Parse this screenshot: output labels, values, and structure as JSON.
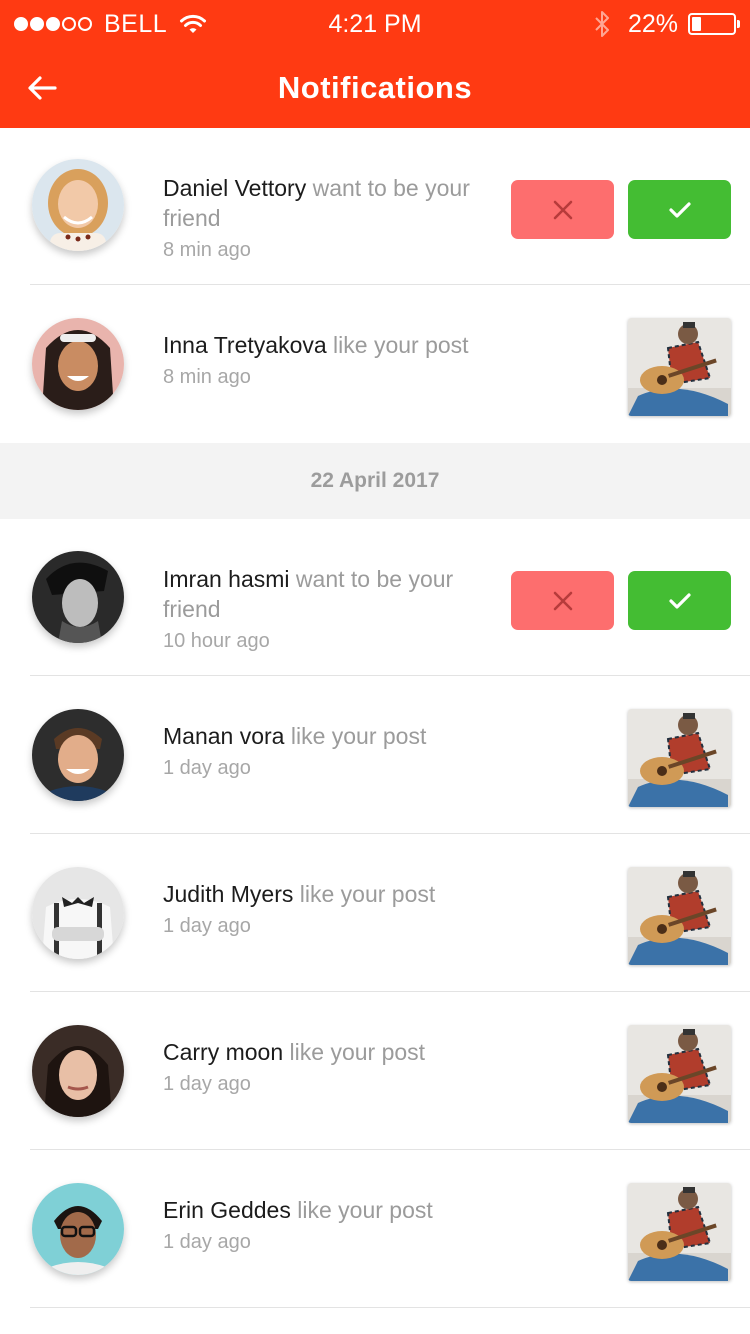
{
  "status_bar": {
    "carrier": "BELL",
    "time": "4:21 PM",
    "battery_percent": "22%",
    "battery_level": 0.22,
    "signal_bars_filled": 3,
    "signal_bars_total": 5
  },
  "header": {
    "title": "Notifications",
    "back_icon": "arrow-left-icon",
    "background": "#ff3a12"
  },
  "colors": {
    "accept": "#44bd33",
    "decline": "#fd6e6e",
    "name_text": "#1c1c1c",
    "secondary_text": "#9b9b9b"
  },
  "notifications": [
    {
      "name": "Daniel Vettory",
      "action": " want to be your friend",
      "time": "8 min ago",
      "type": "friend_request"
    },
    {
      "name": "Inna Tretyakova",
      "action": " like your post",
      "time": "8 min ago",
      "type": "like"
    }
  ],
  "date_separator": "22 April 2017",
  "notifications_dated": [
    {
      "name": "Imran hasmi",
      "action": " want to be your friend",
      "time": "10 hour ago",
      "type": "friend_request"
    },
    {
      "name": "Manan vora",
      "action": " like your post",
      "time": "1 day ago",
      "type": "like"
    },
    {
      "name": "Judith Myers",
      "action": " like your post",
      "time": "1 day ago",
      "type": "like"
    },
    {
      "name": "Carry moon",
      "action": " like your post",
      "time": "1 day ago",
      "type": "like"
    },
    {
      "name": "Erin Geddes",
      "action": " like your post",
      "time": "1 day ago",
      "type": "like"
    }
  ],
  "icons": {
    "decline": "close-icon",
    "accept": "checkmark-icon",
    "wifi": "wifi-icon",
    "bluetooth": "bluetooth-icon",
    "battery": "battery-icon"
  }
}
